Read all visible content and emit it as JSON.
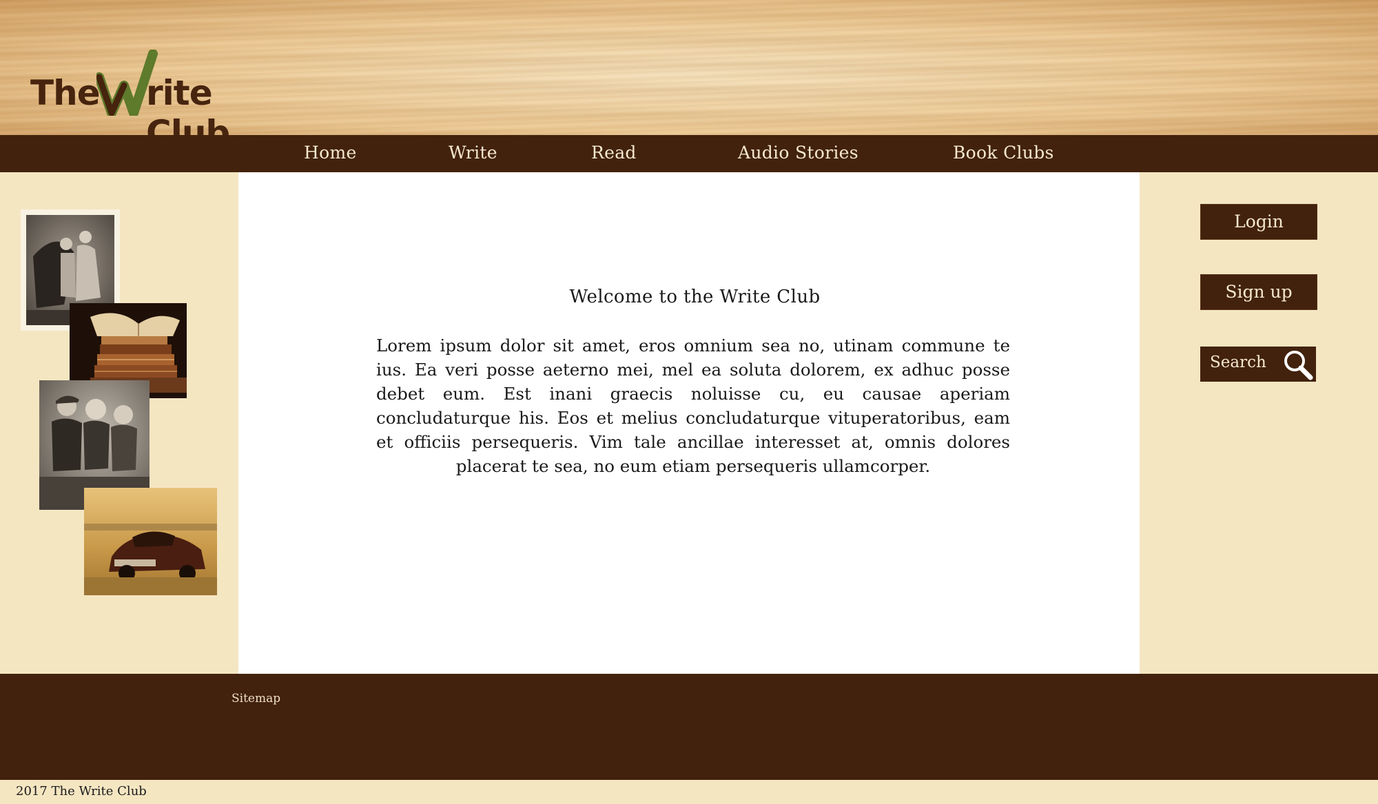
{
  "header": {
    "logo": {
      "part1": "The",
      "part2": "rite Club",
      "accent_color": "#5e7a2b",
      "text_color": "#46240e"
    }
  },
  "nav": {
    "items": [
      {
        "label": "Home"
      },
      {
        "label": "Write"
      },
      {
        "label": "Read"
      },
      {
        "label": "Audio Stories"
      },
      {
        "label": "Book Clubs"
      }
    ]
  },
  "main": {
    "heading": "Welcome to the Write Club",
    "body": "Lorem ipsum dolor sit amet, eros omnium sea no, utinam commune te ius. Ea veri posse aeterno mei, mel ea soluta dolorem, ex adhuc posse debet eum. Est inani graecis noluisse cu, eu causae aperiam concludaturque his. Eos et melius concludaturque vituperatoribus, eam et officiis persequeris. Vim tale ancillae interesset at, omnis dolores placerat te sea, no eum etiam persequeris ullamcorper."
  },
  "sidebar": {
    "login_label": "Login",
    "signup_label": "Sign up",
    "search_label": "Search",
    "search_icon": "magnifier-icon"
  },
  "footer": {
    "sitemap_label": "Sitemap",
    "copyright": "2017 The Write Club"
  },
  "colors": {
    "brown": "#42220d",
    "cream": "#f5e6c2",
    "white": "#ffffff",
    "nav_text": "#f7e8d0"
  }
}
